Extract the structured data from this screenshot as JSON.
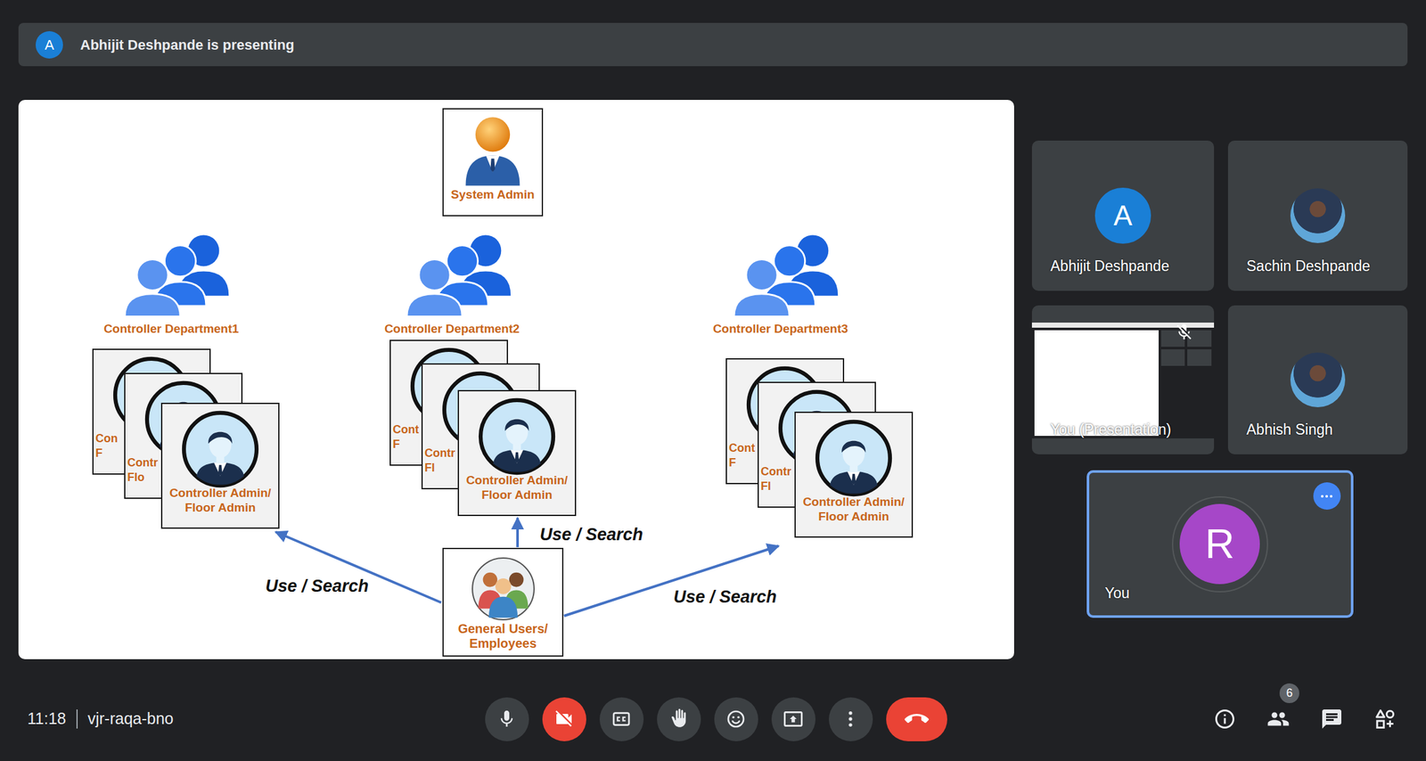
{
  "banner": {
    "avatar": "A",
    "text": "Abhijit Deshpande is presenting"
  },
  "slide": {
    "system_admin": {
      "label": "System Admin"
    },
    "departments": [
      {
        "label": "Controller Department1",
        "cards": [
          {
            "lines": [
              "Con",
              "F"
            ]
          },
          {
            "lines": [
              "Contr",
              "Flo"
            ]
          },
          {
            "lines": [
              "Controller Admin/",
              "Floor Admin"
            ]
          }
        ]
      },
      {
        "label": "Controller Department2",
        "cards": [
          {
            "lines": [
              "Cont",
              "F"
            ]
          },
          {
            "lines": [
              "Contr",
              "Fl"
            ]
          },
          {
            "lines": [
              "Controller Admin/",
              "Floor Admin"
            ]
          }
        ]
      },
      {
        "label": "Controller Department3",
        "cards": [
          {
            "lines": [
              "Cont",
              "F"
            ]
          },
          {
            "lines": [
              "Contr",
              "Fl"
            ]
          },
          {
            "lines": [
              "Controller Admin/",
              "Floor Admin"
            ]
          }
        ]
      }
    ],
    "users": {
      "lines": [
        "General Users/",
        "Employees"
      ]
    },
    "links": [
      {
        "label": "Use / Search"
      },
      {
        "label": "Use / Search"
      },
      {
        "label": "Use / Search"
      }
    ]
  },
  "participants": [
    {
      "name": "Abhijit Deshpande",
      "kind": "initial",
      "initial": "A",
      "color": "#1a7fd6",
      "muted": false,
      "selected": false
    },
    {
      "name": "Sachin Deshpande",
      "kind": "photo",
      "muted": false,
      "selected": false
    },
    {
      "name": "You (Presentation)",
      "kind": "presentation",
      "muted": true,
      "selected": false
    },
    {
      "name": "Abhish Singh",
      "kind": "photo",
      "muted": false,
      "selected": false
    },
    {
      "name": "You",
      "kind": "initial",
      "initial": "R",
      "color": "#a647c8",
      "muted": false,
      "selected": true
    }
  ],
  "meeting": {
    "time": "11:18",
    "code": "vjr-raqa-bno"
  },
  "controls": [
    {
      "kind": "mic",
      "on": true
    },
    {
      "kind": "camera",
      "on": false
    },
    {
      "kind": "captions",
      "on": false
    },
    {
      "kind": "hand",
      "on": false
    },
    {
      "kind": "emoji"
    },
    {
      "kind": "present"
    },
    {
      "kind": "more"
    },
    {
      "kind": "leave"
    }
  ],
  "side_buttons": [
    {
      "kind": "info"
    },
    {
      "kind": "people",
      "badge": "6"
    },
    {
      "kind": "chat"
    },
    {
      "kind": "activities"
    }
  ]
}
